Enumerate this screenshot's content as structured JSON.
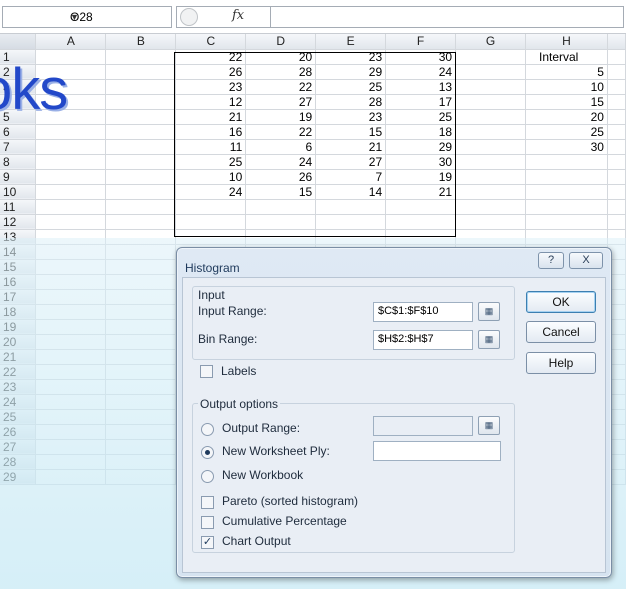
{
  "namebox": {
    "value": "O28",
    "dropdown_icon": "dropdown-arrow-icon"
  },
  "formula_bar": {
    "fx_label": "fx",
    "fx_icon": "function-icon",
    "value": ""
  },
  "sheet": {
    "columns": [
      "A",
      "B",
      "C",
      "D",
      "E",
      "F",
      "G",
      "H"
    ],
    "rows": [
      {
        "n": "1",
        "C": "22",
        "D": "20",
        "E": "23",
        "F": "30",
        "H": "Interval"
      },
      {
        "n": "2",
        "C": "26",
        "D": "28",
        "E": "29",
        "F": "24",
        "H": "5"
      },
      {
        "n": "3",
        "C": "23",
        "D": "22",
        "E": "25",
        "F": "13",
        "H": "10"
      },
      {
        "n": "4",
        "C": "12",
        "D": "27",
        "E": "28",
        "F": "17",
        "H": "15"
      },
      {
        "n": "5",
        "C": "21",
        "D": "19",
        "E": "23",
        "F": "25",
        "H": "20"
      },
      {
        "n": "6",
        "C": "16",
        "D": "22",
        "E": "15",
        "F": "18",
        "H": "25"
      },
      {
        "n": "7",
        "C": "11",
        "D": "6",
        "E": "21",
        "F": "29",
        "H": "30"
      },
      {
        "n": "8",
        "C": "25",
        "D": "24",
        "E": "27",
        "F": "30"
      },
      {
        "n": "9",
        "C": "10",
        "D": "26",
        "E": "7",
        "F": "19"
      },
      {
        "n": "10",
        "C": "24",
        "D": "15",
        "E": "14",
        "F": "21"
      },
      {
        "n": "11"
      },
      {
        "n": "12"
      },
      {
        "n": "13"
      },
      {
        "n": "14"
      },
      {
        "n": "15"
      },
      {
        "n": "16"
      },
      {
        "n": "17"
      },
      {
        "n": "18"
      },
      {
        "n": "19"
      },
      {
        "n": "20"
      },
      {
        "n": "21"
      },
      {
        "n": "22"
      },
      {
        "n": "23"
      },
      {
        "n": "24"
      },
      {
        "n": "25"
      },
      {
        "n": "26"
      },
      {
        "n": "27"
      },
      {
        "n": "28"
      },
      {
        "n": "29"
      }
    ]
  },
  "watermark": {
    "text": "oks"
  },
  "dialog": {
    "title": "Histogram",
    "help_icon": "?",
    "close_icon": "X",
    "input_group": {
      "title": "Input",
      "input_range_label": "Input Range:",
      "input_range_value": "$C$1:$F$10",
      "bin_range_label": "Bin Range:",
      "bin_range_value": "$H$2:$H$7",
      "labels_label": "Labels",
      "labels_checked": false
    },
    "output_group": {
      "title": "Output options",
      "output_range_label": "Output Range:",
      "output_range_value": "",
      "new_ply_label": "New Worksheet Ply:",
      "new_ply_value": "",
      "new_workbook_label": "New Workbook",
      "selected": "new_ply",
      "pareto_label": "Pareto (sorted histogram)",
      "cumulative_label": "Cumulative Percentage",
      "chart_output_label": "Chart Output",
      "pareto_checked": false,
      "cumulative_checked": false,
      "chart_output_checked": true
    },
    "buttons": {
      "ok": "OK",
      "cancel": "Cancel",
      "help": "Help"
    }
  }
}
